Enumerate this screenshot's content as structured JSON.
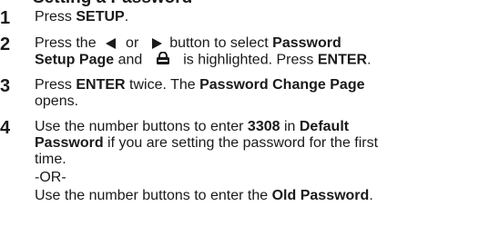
{
  "heading_fragment": "Setting a Password",
  "steps": [
    {
      "num": "1",
      "lines": [
        {
          "pre": "Press ",
          "b1": "SETUP",
          "post": "."
        }
      ]
    },
    {
      "num": "2",
      "l1_pre": "Press the",
      "l1_mid": "or",
      "l1_post": "button to select",
      "l1_bold": "Password",
      "l2_bold": "Setup Page",
      "l2_and": "and",
      "l2_mid": "is highlighted. Press",
      "l2_bold2": "ENTER",
      "l2_end": "."
    },
    {
      "num": "3",
      "l1_pre": "Press ",
      "l1_bold": "ENTER",
      "l1_mid": " twice. The ",
      "l1_bold2": "Password Change Page",
      "l2": "opens."
    },
    {
      "num": "4",
      "l1_pre": "Use the number buttons to enter ",
      "l1_bold": "3308",
      "l1_mid": " in ",
      "l1_bold2": "Default",
      "l2_bold": "Password",
      "l2_post": " if you are setting the password for the first",
      "l3": "time.",
      "l4": "-OR-",
      "l5_pre": "Use the number buttons to enter the ",
      "l5_bold": "Old Password",
      "l5_end": "."
    }
  ],
  "icons": {
    "left": "left-triangle-icon",
    "right": "right-triangle-icon",
    "lock": "padlock-icon"
  }
}
